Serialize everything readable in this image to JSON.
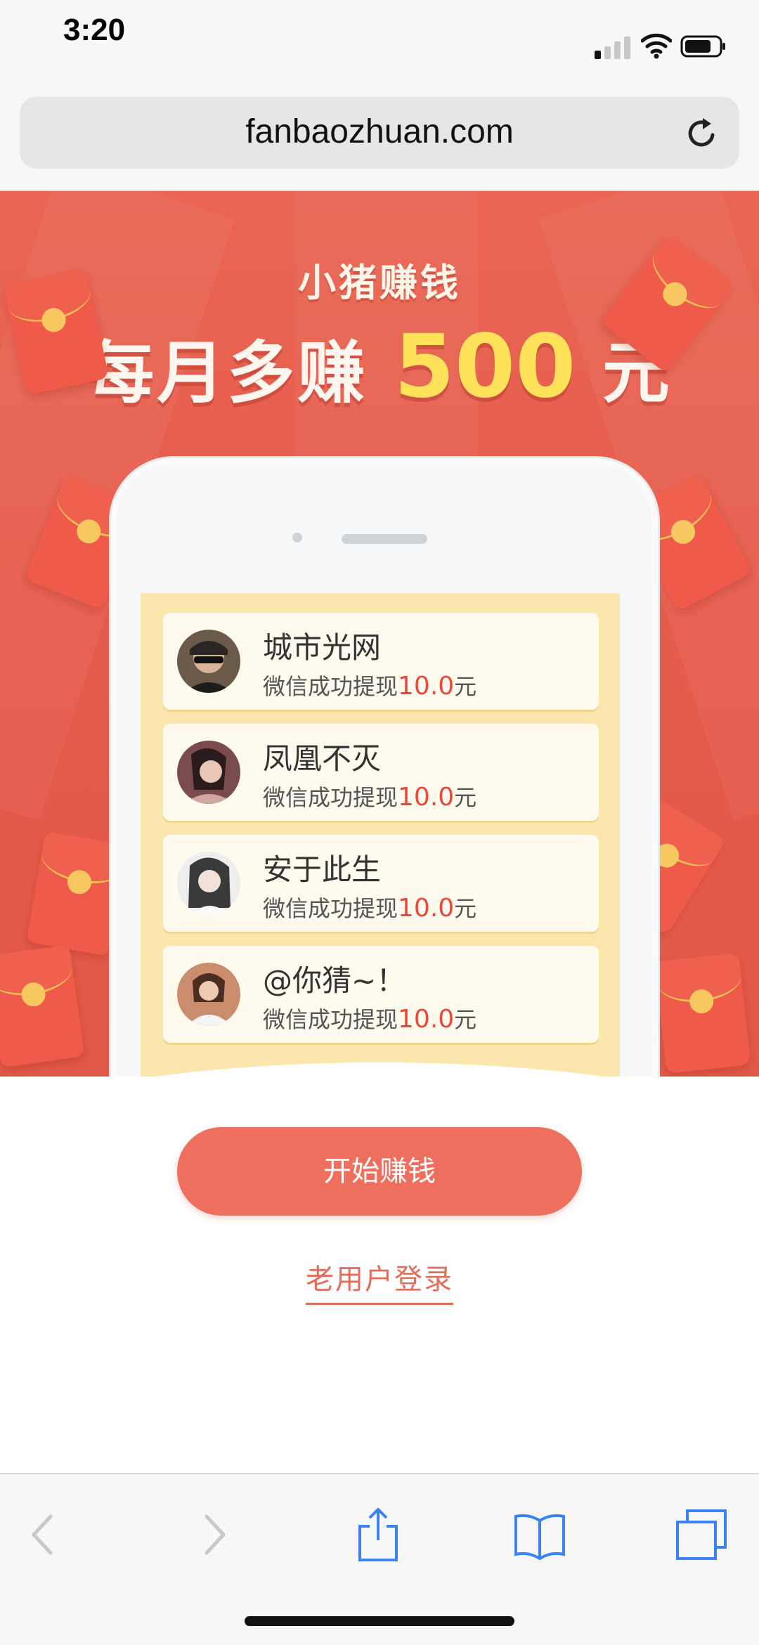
{
  "status_bar": {
    "time": "3:20"
  },
  "browser": {
    "url": "fanbaozhuan.com"
  },
  "banner": {
    "kicker": "小猪赚钱",
    "headline_prefix": "每月多赚",
    "headline_amount": "500",
    "headline_suffix": "元"
  },
  "withdrawals": [
    {
      "name": "城市光网",
      "text": "微信成功提现",
      "amount": "10.0",
      "unit": "元"
    },
    {
      "name": "凤凰不灭",
      "text": "微信成功提现",
      "amount": "10.0",
      "unit": "元"
    },
    {
      "name": "安于此生",
      "text": "微信成功提现",
      "amount": "10.0",
      "unit": "元"
    },
    {
      "name": "@你猜~！",
      "text": "微信成功提现",
      "amount": "10.0",
      "unit": "元"
    }
  ],
  "cta": {
    "start_label": "开始赚钱",
    "login_label": "老用户登录"
  },
  "colors": {
    "accent": "#ee6f5e",
    "banner_bg": "#e55c4c",
    "amount": "#ffe15a",
    "money_red": "#e8493a"
  }
}
